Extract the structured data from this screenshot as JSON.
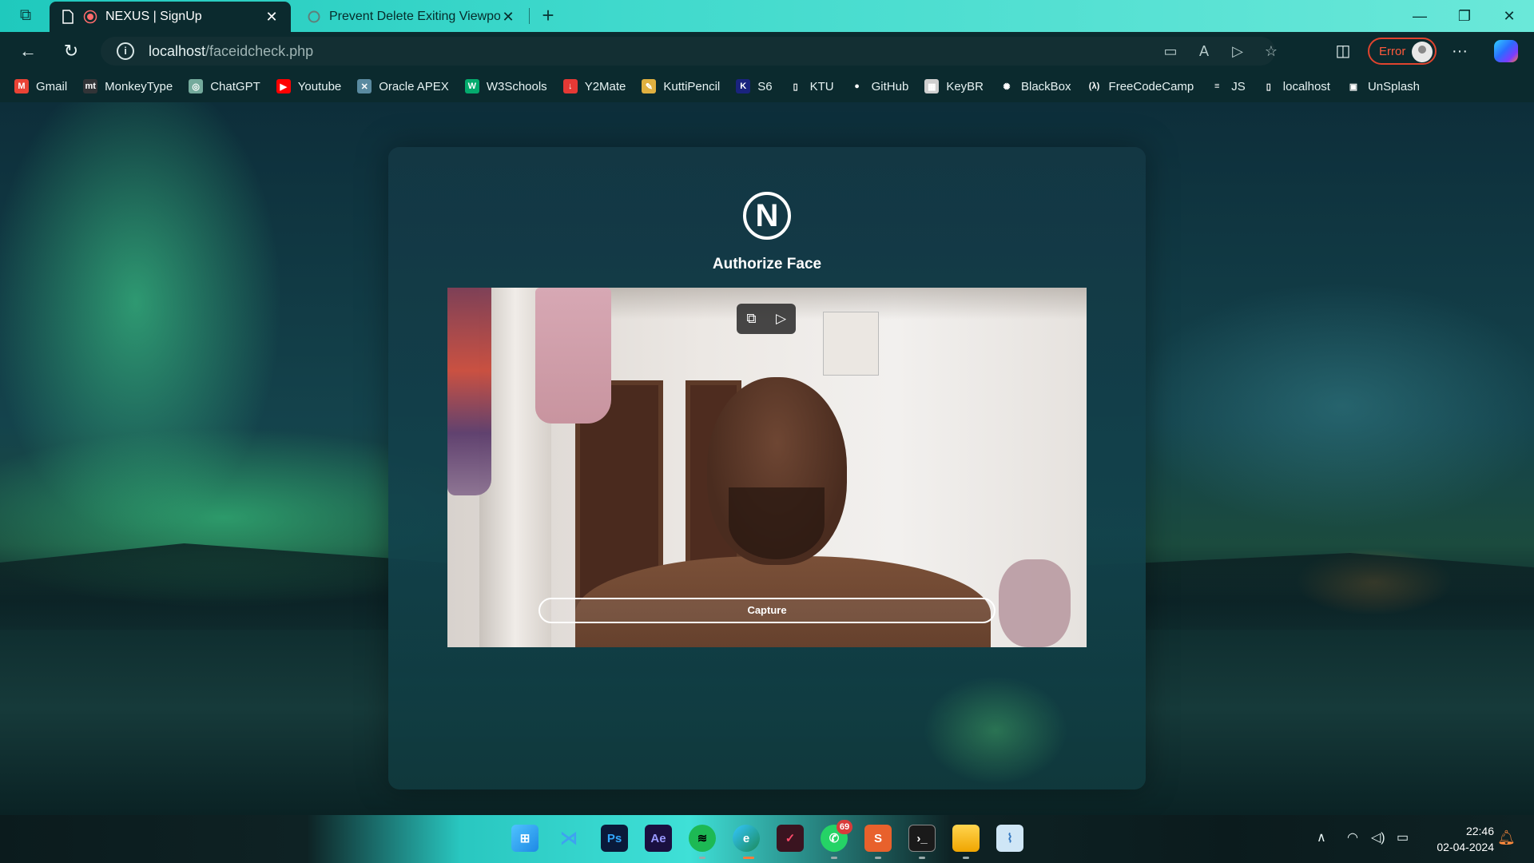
{
  "browser": {
    "tabs": [
      {
        "title": "NEXUS | SignUp",
        "active": true
      },
      {
        "title": "Prevent Delete Exiting Viewport",
        "active": false
      }
    ],
    "address": {
      "host": "localhost",
      "path": "/faceidcheck.php"
    },
    "profile": {
      "status": "Error"
    },
    "bookmarks": [
      {
        "label": "Gmail",
        "icon": "gmail-icon",
        "color": "#ea4335"
      },
      {
        "label": "MonkeyType",
        "icon": "monkeytype-icon",
        "color": "#323437"
      },
      {
        "label": "ChatGPT",
        "icon": "chatgpt-icon",
        "color": "#74aa9c"
      },
      {
        "label": "Youtube",
        "icon": "youtube-icon",
        "color": "#ff0000"
      },
      {
        "label": "Oracle APEX",
        "icon": "oracle-apex-icon",
        "color": "#5a8aa0"
      },
      {
        "label": "W3Schools",
        "icon": "w3schools-icon",
        "color": "#04aa6d"
      },
      {
        "label": "Y2Mate",
        "icon": "y2mate-icon",
        "color": "#e53935"
      },
      {
        "label": "KuttiPencil",
        "icon": "pencil-icon",
        "color": "#e0b040"
      },
      {
        "label": "S6",
        "icon": "k-icon",
        "color": "#1a237e"
      },
      {
        "label": "KTU",
        "icon": "page-icon",
        "color": "#0b2a2e"
      },
      {
        "label": "GitHub",
        "icon": "github-icon",
        "color": "#0b2a2e"
      },
      {
        "label": "KeyBR",
        "icon": "keybr-icon",
        "color": "#cfcfcf"
      },
      {
        "label": "BlackBox",
        "icon": "blackbox-icon",
        "color": "#0b2a2e"
      },
      {
        "label": "FreeCodeCamp",
        "icon": "freecodecamp-icon",
        "color": "#0b2a2e"
      },
      {
        "label": "JS",
        "icon": "js-icon",
        "color": "#0b2a2e"
      },
      {
        "label": "localhost",
        "icon": "page-icon",
        "color": "#0b2a2e"
      },
      {
        "label": "UnSplash",
        "icon": "unsplash-icon",
        "color": "#0b2a2e"
      }
    ]
  },
  "page": {
    "logo_letter": "N",
    "title": "Authorize Face",
    "capture_label": "Capture"
  },
  "taskbar": {
    "whatsapp_badge": "69",
    "time": "22:46",
    "date": "02-04-2024"
  }
}
